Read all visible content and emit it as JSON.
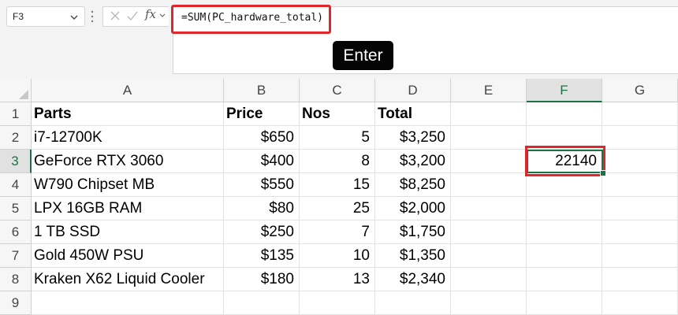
{
  "namebox": {
    "value": "F3"
  },
  "formula_bar": {
    "fx_label": "fx",
    "formula": "=SUM(PC_hardware_total)"
  },
  "overlay": {
    "enter_key": "Enter"
  },
  "columns": [
    "A",
    "B",
    "C",
    "D",
    "E",
    "F",
    "G"
  ],
  "active_column": "F",
  "rows": [
    "1",
    "2",
    "3",
    "4",
    "5",
    "6",
    "7",
    "8",
    "9"
  ],
  "active_row": "3",
  "table": {
    "headers": [
      "Parts",
      "Price",
      "Nos",
      "Total"
    ],
    "rows": [
      [
        "i7-12700K",
        "$650",
        "5",
        "$3,250"
      ],
      [
        "GeForce RTX 3060",
        "$400",
        "8",
        "$3,200"
      ],
      [
        "W790 Chipset MB",
        "$550",
        "15",
        "$8,250"
      ],
      [
        "LPX 16GB RAM",
        "$80",
        "25",
        "$2,000"
      ],
      [
        "1 TB SSD",
        "$250",
        "7",
        "$1,750"
      ],
      [
        "Gold 450W PSU",
        "$135",
        "10",
        "$1,350"
      ],
      [
        "Kraken X62 Liquid Cooler",
        "$180",
        "13",
        "$2,340"
      ]
    ]
  },
  "selected_cell": {
    "ref": "F3",
    "value": "22140"
  },
  "colors": {
    "highlight": "#e0262a",
    "selection": "#1e7145"
  }
}
